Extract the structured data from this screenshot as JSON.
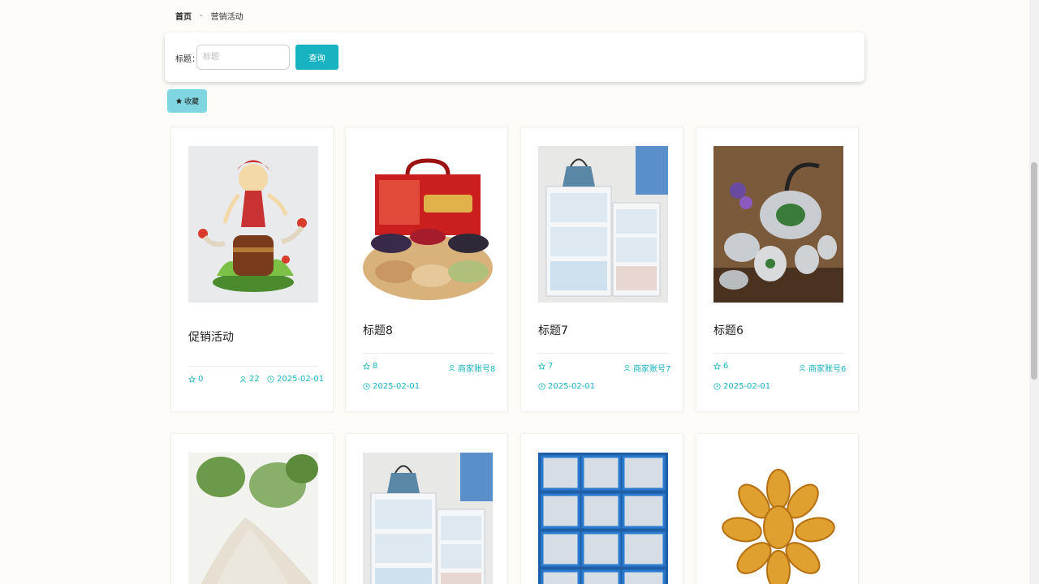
{
  "breadcrumb": {
    "home": "首页",
    "separator": "-",
    "current": "营销活动"
  },
  "search": {
    "label": "标题：",
    "placeholder": "标题",
    "value": "",
    "button": "查询"
  },
  "favorite": {
    "label": "收藏",
    "icon": "star-filled-icon"
  },
  "colors": {
    "accent": "#17b3c1",
    "favorite_bg": "#7fd6e0"
  },
  "cards": [
    {
      "title": "促销活动",
      "likes": "0",
      "views": "22",
      "date": "2025-02-01",
      "merchant": "",
      "image": "anime-figure"
    },
    {
      "title": "标题8",
      "likes": "8",
      "merchant": "商家账号8",
      "date": "2025-02-01",
      "image": "nut-gift-box"
    },
    {
      "title": "标题7",
      "likes": "7",
      "merchant": "商家账号7",
      "date": "2025-02-01",
      "image": "storage-drawers"
    },
    {
      "title": "标题6",
      "likes": "6",
      "merchant": "商家账号6",
      "date": "2025-02-01",
      "image": "tea-set"
    },
    {
      "title": "",
      "image": "flour-pile"
    },
    {
      "title": "",
      "image": "storage-drawers"
    },
    {
      "title": "",
      "image": "fish-trays"
    },
    {
      "title": "",
      "image": "abalone"
    }
  ]
}
